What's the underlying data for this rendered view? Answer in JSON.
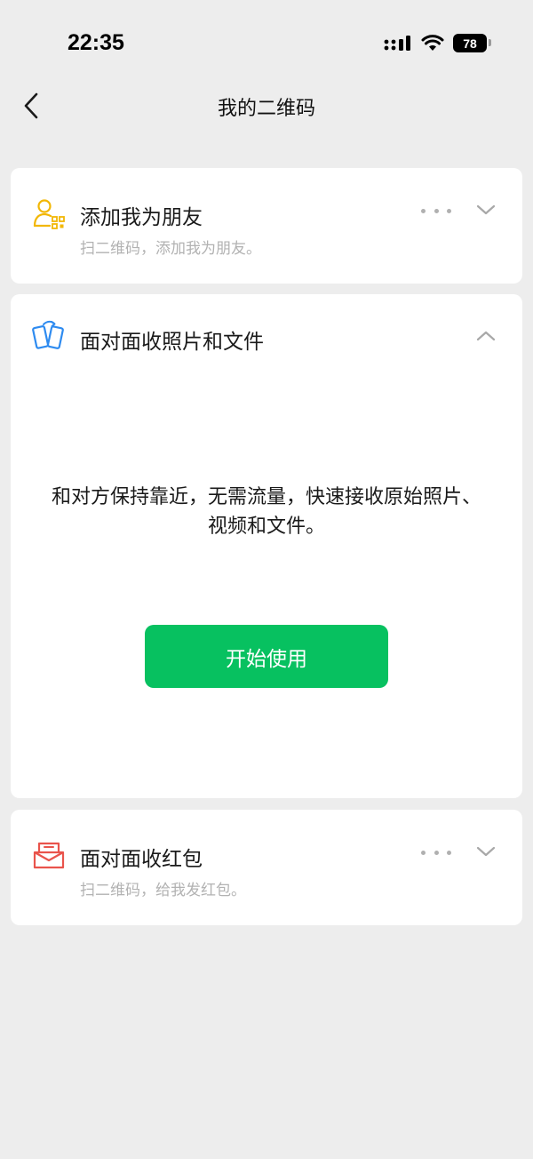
{
  "status_bar": {
    "time": "22:35",
    "battery": "78"
  },
  "nav": {
    "title": "我的二维码"
  },
  "cards": {
    "add_friend": {
      "title": "添加我为朋友",
      "desc": "扫二维码，添加我为朋友。",
      "icon": "qr-person-icon",
      "icon_color": "#f2b705"
    },
    "face_to_face": {
      "title": "面对面收照片和文件",
      "desc": "和对方保持靠近，无需流量，快速接收原始照片、视频和文件。",
      "button_label": "开始使用",
      "icon": "two-phones-icon",
      "icon_color": "#2e8bf0",
      "button_color": "#07c160"
    },
    "red_packet": {
      "title": "面对面收红包",
      "desc": "扫二维码，给我发红包。",
      "icon": "red-packet-icon",
      "icon_color": "#e9544c"
    }
  },
  "colors": {
    "background": "#ededed",
    "card": "#ffffff",
    "secondary_text": "#b2b2b2"
  }
}
